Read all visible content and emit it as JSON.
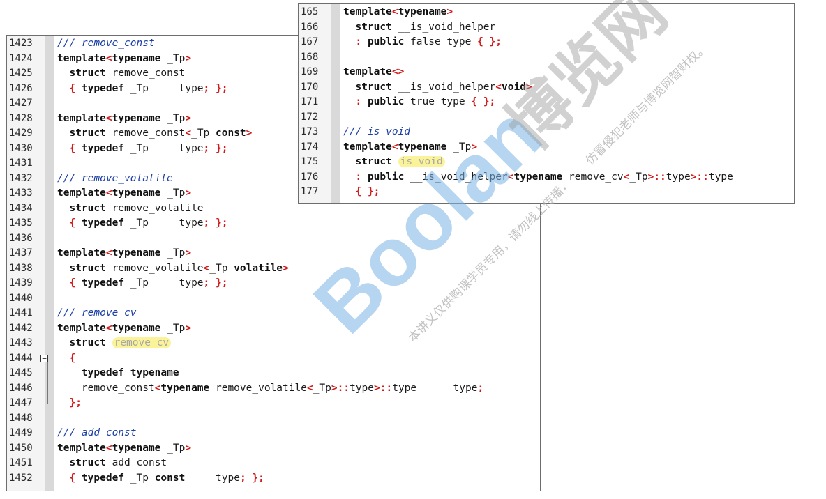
{
  "left_panel": {
    "lines": [
      {
        "num": "1423",
        "segments": [
          {
            "t": "/// remove_const",
            "c": "comment"
          }
        ]
      },
      {
        "num": "1424",
        "segments": [
          {
            "t": "template",
            "c": "kw"
          },
          {
            "t": "<",
            "c": "punct"
          },
          {
            "t": "typename",
            "c": "kw"
          },
          {
            "t": " _Tp",
            "c": ""
          },
          {
            "t": ">",
            "c": "punct"
          }
        ]
      },
      {
        "num": "1425",
        "segments": [
          {
            "t": "  ",
            "c": ""
          },
          {
            "t": "struct",
            "c": "kw"
          },
          {
            "t": " remove_const",
            "c": ""
          }
        ]
      },
      {
        "num": "1426",
        "segments": [
          {
            "t": "  ",
            "c": ""
          },
          {
            "t": "{",
            "c": "punct"
          },
          {
            "t": " ",
            "c": ""
          },
          {
            "t": "typedef",
            "c": "kw"
          },
          {
            "t": " _Tp     type",
            "c": ""
          },
          {
            "t": ";",
            "c": "punct"
          },
          {
            "t": " ",
            "c": ""
          },
          {
            "t": "};",
            "c": "punct"
          }
        ]
      },
      {
        "num": "1427",
        "segments": []
      },
      {
        "num": "1428",
        "segments": [
          {
            "t": "template",
            "c": "kw"
          },
          {
            "t": "<",
            "c": "punct"
          },
          {
            "t": "typename",
            "c": "kw"
          },
          {
            "t": " _Tp",
            "c": ""
          },
          {
            "t": ">",
            "c": "punct"
          }
        ]
      },
      {
        "num": "1429",
        "segments": [
          {
            "t": "  ",
            "c": ""
          },
          {
            "t": "struct",
            "c": "kw"
          },
          {
            "t": " remove_const",
            "c": ""
          },
          {
            "t": "<",
            "c": "punct"
          },
          {
            "t": "_Tp ",
            "c": ""
          },
          {
            "t": "const",
            "c": "kw"
          },
          {
            "t": ">",
            "c": "punct"
          }
        ]
      },
      {
        "num": "1430",
        "segments": [
          {
            "t": "  ",
            "c": ""
          },
          {
            "t": "{",
            "c": "punct"
          },
          {
            "t": " ",
            "c": ""
          },
          {
            "t": "typedef",
            "c": "kw"
          },
          {
            "t": " _Tp     type",
            "c": ""
          },
          {
            "t": ";",
            "c": "punct"
          },
          {
            "t": " ",
            "c": ""
          },
          {
            "t": "};",
            "c": "punct"
          }
        ]
      },
      {
        "num": "1431",
        "segments": []
      },
      {
        "num": "1432",
        "segments": [
          {
            "t": "/// remove_volatile",
            "c": "comment"
          }
        ]
      },
      {
        "num": "1433",
        "segments": [
          {
            "t": "template",
            "c": "kw"
          },
          {
            "t": "<",
            "c": "punct"
          },
          {
            "t": "typename",
            "c": "kw"
          },
          {
            "t": " _Tp",
            "c": ""
          },
          {
            "t": ">",
            "c": "punct"
          }
        ]
      },
      {
        "num": "1434",
        "segments": [
          {
            "t": "  ",
            "c": ""
          },
          {
            "t": "struct",
            "c": "kw"
          },
          {
            "t": " remove_volatile",
            "c": ""
          }
        ]
      },
      {
        "num": "1435",
        "segments": [
          {
            "t": "  ",
            "c": ""
          },
          {
            "t": "{",
            "c": "punct"
          },
          {
            "t": " ",
            "c": ""
          },
          {
            "t": "typedef",
            "c": "kw"
          },
          {
            "t": " _Tp     type",
            "c": ""
          },
          {
            "t": ";",
            "c": "punct"
          },
          {
            "t": " ",
            "c": ""
          },
          {
            "t": "};",
            "c": "punct"
          }
        ]
      },
      {
        "num": "1436",
        "segments": []
      },
      {
        "num": "1437",
        "segments": [
          {
            "t": "template",
            "c": "kw"
          },
          {
            "t": "<",
            "c": "punct"
          },
          {
            "t": "typename",
            "c": "kw"
          },
          {
            "t": " _Tp",
            "c": ""
          },
          {
            "t": ">",
            "c": "punct"
          }
        ]
      },
      {
        "num": "1438",
        "segments": [
          {
            "t": "  ",
            "c": ""
          },
          {
            "t": "struct",
            "c": "kw"
          },
          {
            "t": " remove_volatile",
            "c": ""
          },
          {
            "t": "<",
            "c": "punct"
          },
          {
            "t": "_Tp ",
            "c": ""
          },
          {
            "t": "volatile",
            "c": "kw"
          },
          {
            "t": ">",
            "c": "punct"
          }
        ]
      },
      {
        "num": "1439",
        "segments": [
          {
            "t": "  ",
            "c": ""
          },
          {
            "t": "{",
            "c": "punct"
          },
          {
            "t": " ",
            "c": ""
          },
          {
            "t": "typedef",
            "c": "kw"
          },
          {
            "t": " _Tp     type",
            "c": ""
          },
          {
            "t": ";",
            "c": "punct"
          },
          {
            "t": " ",
            "c": ""
          },
          {
            "t": "};",
            "c": "punct"
          }
        ]
      },
      {
        "num": "1440",
        "segments": []
      },
      {
        "num": "1441",
        "segments": [
          {
            "t": "/// remove_cv",
            "c": "comment"
          }
        ]
      },
      {
        "num": "1442",
        "segments": [
          {
            "t": "template",
            "c": "kw"
          },
          {
            "t": "<",
            "c": "punct"
          },
          {
            "t": "typename",
            "c": "kw"
          },
          {
            "t": " _Tp",
            "c": ""
          },
          {
            "t": ">",
            "c": "punct"
          }
        ]
      },
      {
        "num": "1443",
        "segments": [
          {
            "t": "  ",
            "c": ""
          },
          {
            "t": "struct",
            "c": "kw"
          },
          {
            "t": " ",
            "c": ""
          },
          {
            "t": "remove_cv",
            "c": "hl"
          }
        ]
      },
      {
        "num": "1444",
        "segments": [
          {
            "t": "  ",
            "c": ""
          },
          {
            "t": "{",
            "c": "punct"
          }
        ]
      },
      {
        "num": "1445",
        "segments": [
          {
            "t": "    ",
            "c": ""
          },
          {
            "t": "typedef",
            "c": "kw"
          },
          {
            "t": " ",
            "c": ""
          },
          {
            "t": "typename",
            "c": "kw"
          }
        ]
      },
      {
        "num": "1446",
        "segments": [
          {
            "t": "    remove_const",
            "c": ""
          },
          {
            "t": "<",
            "c": "punct"
          },
          {
            "t": "typename",
            "c": "kw"
          },
          {
            "t": " remove_volatile",
            "c": ""
          },
          {
            "t": "<",
            "c": "punct"
          },
          {
            "t": "_Tp",
            "c": ""
          },
          {
            "t": ">::",
            "c": "punct"
          },
          {
            "t": "type",
            "c": ""
          },
          {
            "t": ">::",
            "c": "punct"
          },
          {
            "t": "type      type",
            "c": ""
          },
          {
            "t": ";",
            "c": "punct"
          }
        ]
      },
      {
        "num": "1447",
        "segments": [
          {
            "t": "  ",
            "c": ""
          },
          {
            "t": "};",
            "c": "punct"
          }
        ]
      },
      {
        "num": "1448",
        "segments": []
      },
      {
        "num": "1449",
        "segments": [
          {
            "t": "/// add_const",
            "c": "comment"
          }
        ]
      },
      {
        "num": "1450",
        "segments": [
          {
            "t": "template",
            "c": "kw"
          },
          {
            "t": "<",
            "c": "punct"
          },
          {
            "t": "typename",
            "c": "kw"
          },
          {
            "t": " _Tp",
            "c": ""
          },
          {
            "t": ">",
            "c": "punct"
          }
        ]
      },
      {
        "num": "1451",
        "segments": [
          {
            "t": "  ",
            "c": ""
          },
          {
            "t": "struct",
            "c": "kw"
          },
          {
            "t": " add_const",
            "c": ""
          }
        ]
      },
      {
        "num": "1452",
        "segments": [
          {
            "t": "  ",
            "c": ""
          },
          {
            "t": "{",
            "c": "punct"
          },
          {
            "t": " ",
            "c": ""
          },
          {
            "t": "typedef",
            "c": "kw"
          },
          {
            "t": " _Tp ",
            "c": ""
          },
          {
            "t": "const",
            "c": "kw"
          },
          {
            "t": "     type",
            "c": ""
          },
          {
            "t": ";",
            "c": "punct"
          },
          {
            "t": " ",
            "c": ""
          },
          {
            "t": "};",
            "c": "punct"
          }
        ]
      }
    ]
  },
  "right_panel": {
    "lines": [
      {
        "num": "165",
        "segments": [
          {
            "t": "template",
            "c": "kw"
          },
          {
            "t": "<",
            "c": "punct"
          },
          {
            "t": "typename",
            "c": "kw"
          },
          {
            "t": ">",
            "c": "punct"
          }
        ]
      },
      {
        "num": "166",
        "segments": [
          {
            "t": "  ",
            "c": ""
          },
          {
            "t": "struct",
            "c": "kw"
          },
          {
            "t": " __is_void_helper",
            "c": ""
          }
        ]
      },
      {
        "num": "167",
        "segments": [
          {
            "t": "  ",
            "c": ""
          },
          {
            "t": ":",
            "c": "punct"
          },
          {
            "t": " ",
            "c": ""
          },
          {
            "t": "public",
            "c": "kw"
          },
          {
            "t": " false_type ",
            "c": ""
          },
          {
            "t": "{",
            "c": "punct"
          },
          {
            "t": " ",
            "c": ""
          },
          {
            "t": "};",
            "c": "punct"
          }
        ]
      },
      {
        "num": "168",
        "segments": []
      },
      {
        "num": "169",
        "segments": [
          {
            "t": "template",
            "c": "kw"
          },
          {
            "t": "<>",
            "c": "punct"
          }
        ]
      },
      {
        "num": "170",
        "segments": [
          {
            "t": "  ",
            "c": ""
          },
          {
            "t": "struct",
            "c": "kw"
          },
          {
            "t": " __is_void_helper",
            "c": ""
          },
          {
            "t": "<",
            "c": "punct"
          },
          {
            "t": "void",
            "c": "kw"
          },
          {
            "t": ">",
            "c": "punct"
          }
        ]
      },
      {
        "num": "171",
        "segments": [
          {
            "t": "  ",
            "c": ""
          },
          {
            "t": ":",
            "c": "punct"
          },
          {
            "t": " ",
            "c": ""
          },
          {
            "t": "public",
            "c": "kw"
          },
          {
            "t": " true_type ",
            "c": ""
          },
          {
            "t": "{",
            "c": "punct"
          },
          {
            "t": " ",
            "c": ""
          },
          {
            "t": "};",
            "c": "punct"
          }
        ]
      },
      {
        "num": "172",
        "segments": []
      },
      {
        "num": "173",
        "segments": [
          {
            "t": "/// is_void",
            "c": "comment"
          }
        ]
      },
      {
        "num": "174",
        "segments": [
          {
            "t": "template",
            "c": "kw"
          },
          {
            "t": "<",
            "c": "punct"
          },
          {
            "t": "typename",
            "c": "kw"
          },
          {
            "t": " _Tp",
            "c": ""
          },
          {
            "t": ">",
            "c": "punct"
          }
        ]
      },
      {
        "num": "175",
        "segments": [
          {
            "t": "  ",
            "c": ""
          },
          {
            "t": "struct",
            "c": "kw"
          },
          {
            "t": " ",
            "c": ""
          },
          {
            "t": "is_void",
            "c": "hl"
          }
        ]
      },
      {
        "num": "176",
        "segments": [
          {
            "t": "  ",
            "c": ""
          },
          {
            "t": ":",
            "c": "punct"
          },
          {
            "t": " ",
            "c": ""
          },
          {
            "t": "public",
            "c": "kw"
          },
          {
            "t": " __is_void_helper",
            "c": ""
          },
          {
            "t": "<",
            "c": "punct"
          },
          {
            "t": "typename",
            "c": "kw"
          },
          {
            "t": " remove_cv",
            "c": ""
          },
          {
            "t": "<",
            "c": "punct"
          },
          {
            "t": "_Tp",
            "c": ""
          },
          {
            "t": ">::",
            "c": "punct"
          },
          {
            "t": "type",
            "c": ""
          },
          {
            "t": ">::",
            "c": "punct"
          },
          {
            "t": "type",
            "c": ""
          }
        ]
      },
      {
        "num": "177",
        "segments": [
          {
            "t": "  ",
            "c": ""
          },
          {
            "t": "{",
            "c": "punct"
          },
          {
            "t": " ",
            "c": ""
          },
          {
            "t": "};",
            "c": "punct"
          }
        ]
      }
    ]
  },
  "fold_marker": {
    "symbol": "−"
  },
  "watermark": {
    "brand": "Boolan",
    "cn_brand": "博览网",
    "notice_1": "本讲义仅供购课学员专用，请勿线上传播，",
    "notice_2": "仿冒侵犯老师与博览网智财权。",
    "colors": {
      "brand": "#7ab3e3",
      "text": "#bfbfbf"
    }
  }
}
